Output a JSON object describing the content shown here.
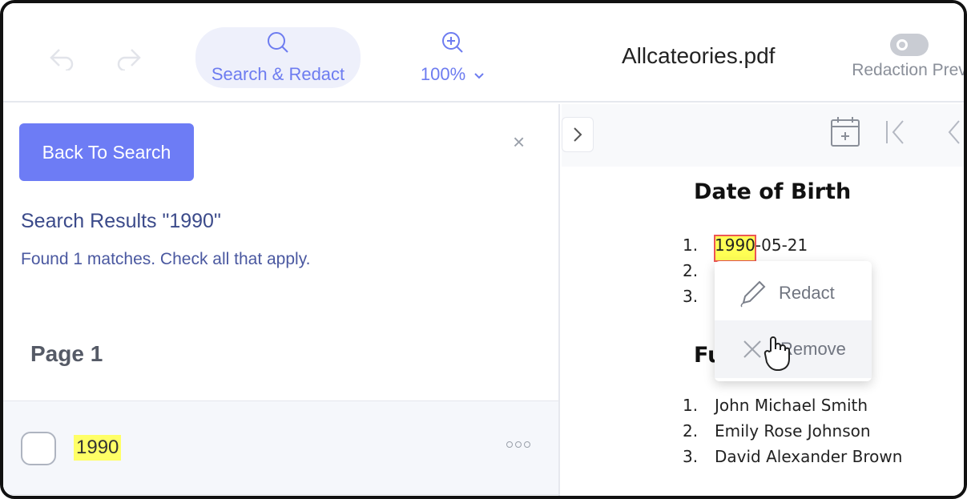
{
  "toolbar": {
    "undo_icon": "undo-icon",
    "redo_icon": "redo-icon",
    "search_tab_label": "Search & Redact",
    "zoom_value": "100%",
    "file_name": "Allcateories.pdf",
    "redaction_preview_label": "Redaction Prev"
  },
  "search_panel": {
    "back_button": "Back To Search",
    "close_symbol": "×",
    "results_title": "Search Results \"1990\"",
    "results_summary": "Found 1 matches. Check all that apply.",
    "page_label": "Page 1",
    "results": [
      {
        "text": "1990",
        "checked": false
      }
    ]
  },
  "document": {
    "section1": {
      "heading": "Date of Birth",
      "items": [
        {
          "num": "1.",
          "highlight": "1990",
          "rest": "-05-21"
        },
        {
          "num": "2.",
          "highlight": "",
          "rest": ""
        },
        {
          "num": "3.",
          "highlight": "",
          "rest": ""
        }
      ]
    },
    "section2": {
      "heading": "Fu",
      "items": [
        {
          "num": "1.",
          "text": "John Michael Smith"
        },
        {
          "num": "2.",
          "text": "Emily Rose Johnson"
        },
        {
          "num": "3.",
          "text": "David Alexander Brown"
        }
      ]
    }
  },
  "context_menu": {
    "redact_label": "Redact",
    "remove_label": "Remove"
  },
  "colors": {
    "accent": "#6d7cf5",
    "highlight": "#ffff55",
    "highlight_border": "#ee5555"
  }
}
